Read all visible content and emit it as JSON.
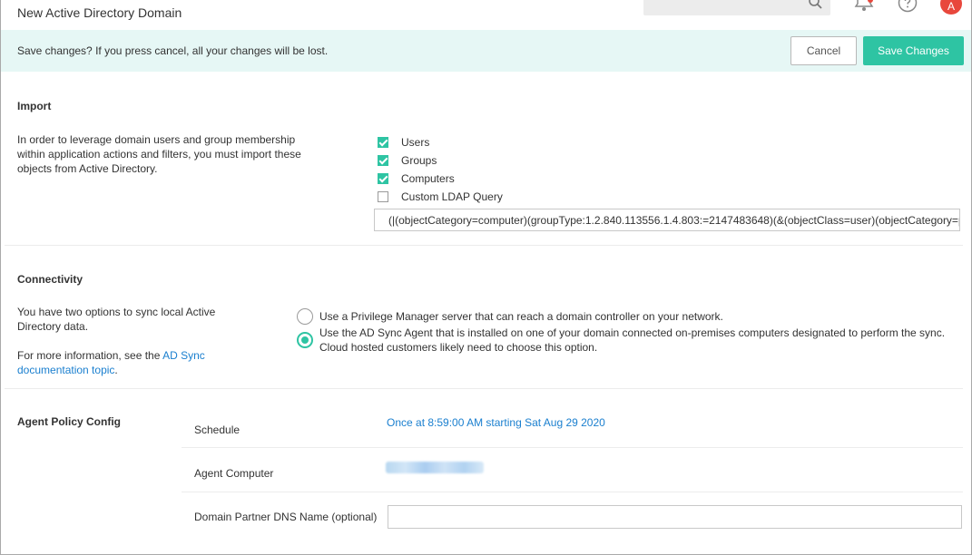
{
  "window": {
    "title": "New Active Directory Domain"
  },
  "header": {
    "avatar_initial": "A"
  },
  "banner": {
    "message": "Save changes? If you press cancel, all your changes will be lost.",
    "cancel_label": "Cancel",
    "save_label": "Save Changes"
  },
  "import": {
    "title": "Import",
    "description": "In order to leverage domain users and group membership within application actions and filters, you must import these objects from Active Directory.",
    "options": [
      {
        "label": "Users",
        "checked": true
      },
      {
        "label": "Groups",
        "checked": true
      },
      {
        "label": "Computers",
        "checked": true
      },
      {
        "label": "Custom LDAP Query",
        "checked": false
      }
    ],
    "ldap_query": "(|(objectCategory=computer)(groupType:1.2.840.113556.1.4.803:=2147483648)(&(objectClass=user)(objectCategory=p"
  },
  "connectivity": {
    "title": "Connectivity",
    "description": "You have two options to sync local Active Directory data.",
    "more_info_prefix": "For more information, see the ",
    "more_info_link": "AD Sync documentation topic",
    "more_info_suffix": ".",
    "options": [
      {
        "label": "Use a Privilege Manager server that can reach a domain controller on your network.",
        "selected": false
      },
      {
        "label": "Use the AD Sync Agent that is installed on one of your domain connected on-premises computers designated to perform the sync. Cloud hosted customers likely need to choose this option.",
        "selected": true
      }
    ]
  },
  "agent_policy": {
    "title": "Agent Policy Config",
    "schedule_label": "Schedule",
    "schedule_value": "Once at 8:59:00 AM starting Sat Aug 29 2020",
    "agent_computer_label": "Agent Computer",
    "dns_label": "Domain Partner DNS Name (optional)",
    "dns_value": ""
  },
  "colors": {
    "accent": "#2ec4a3",
    "banner_bg": "#e6f7f5",
    "link": "#1a7fcf",
    "avatar": "#e8473c"
  },
  "icons": [
    "search-icon",
    "bell-icon",
    "help-icon"
  ]
}
